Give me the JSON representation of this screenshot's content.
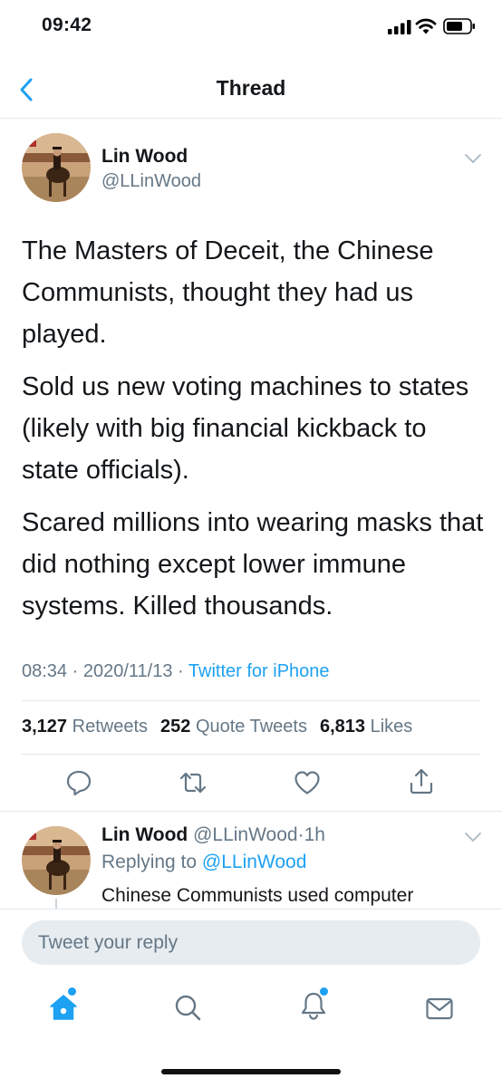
{
  "status_bar": {
    "time": "09:42"
  },
  "nav": {
    "title": "Thread"
  },
  "tweet": {
    "name": "Lin Wood",
    "handle": "@LLinWood",
    "paragraphs": [
      "The Masters of Deceit, the Chinese Communists, thought they had us played.",
      "Sold us new voting machines to states (likely with big financial kickback to state officials).",
      "Scared millions into wearing masks that did nothing except lower immune systems. Killed thousands."
    ],
    "time": "08:34",
    "date": "2020/11/13",
    "separator": "·",
    "source": "Twitter for iPhone",
    "stats": [
      {
        "count": "3,127",
        "label": "Retweets"
      },
      {
        "count": "252",
        "label": "Quote Tweets"
      },
      {
        "count": "6,813",
        "label": "Likes"
      }
    ]
  },
  "reply": {
    "name": "Lin Wood",
    "handle": "@LLinWood",
    "separator": "·",
    "age": "1h",
    "replying_prefix": "Replying to",
    "replying_to": "@LLinWood",
    "text": "Chinese Communists used computer"
  },
  "compose": {
    "placeholder": "Tweet your reply"
  },
  "colors": {
    "accent": "#1da1f2",
    "secondary_text": "#657786",
    "divider": "#e1e8ed"
  },
  "icons": {
    "nav": [
      "back-chevron-icon"
    ],
    "actions": [
      "reply-icon",
      "retweet-icon",
      "like-icon",
      "share-icon"
    ],
    "tabs": [
      "home-icon",
      "search-icon",
      "notifications-icon",
      "messages-icon"
    ]
  }
}
